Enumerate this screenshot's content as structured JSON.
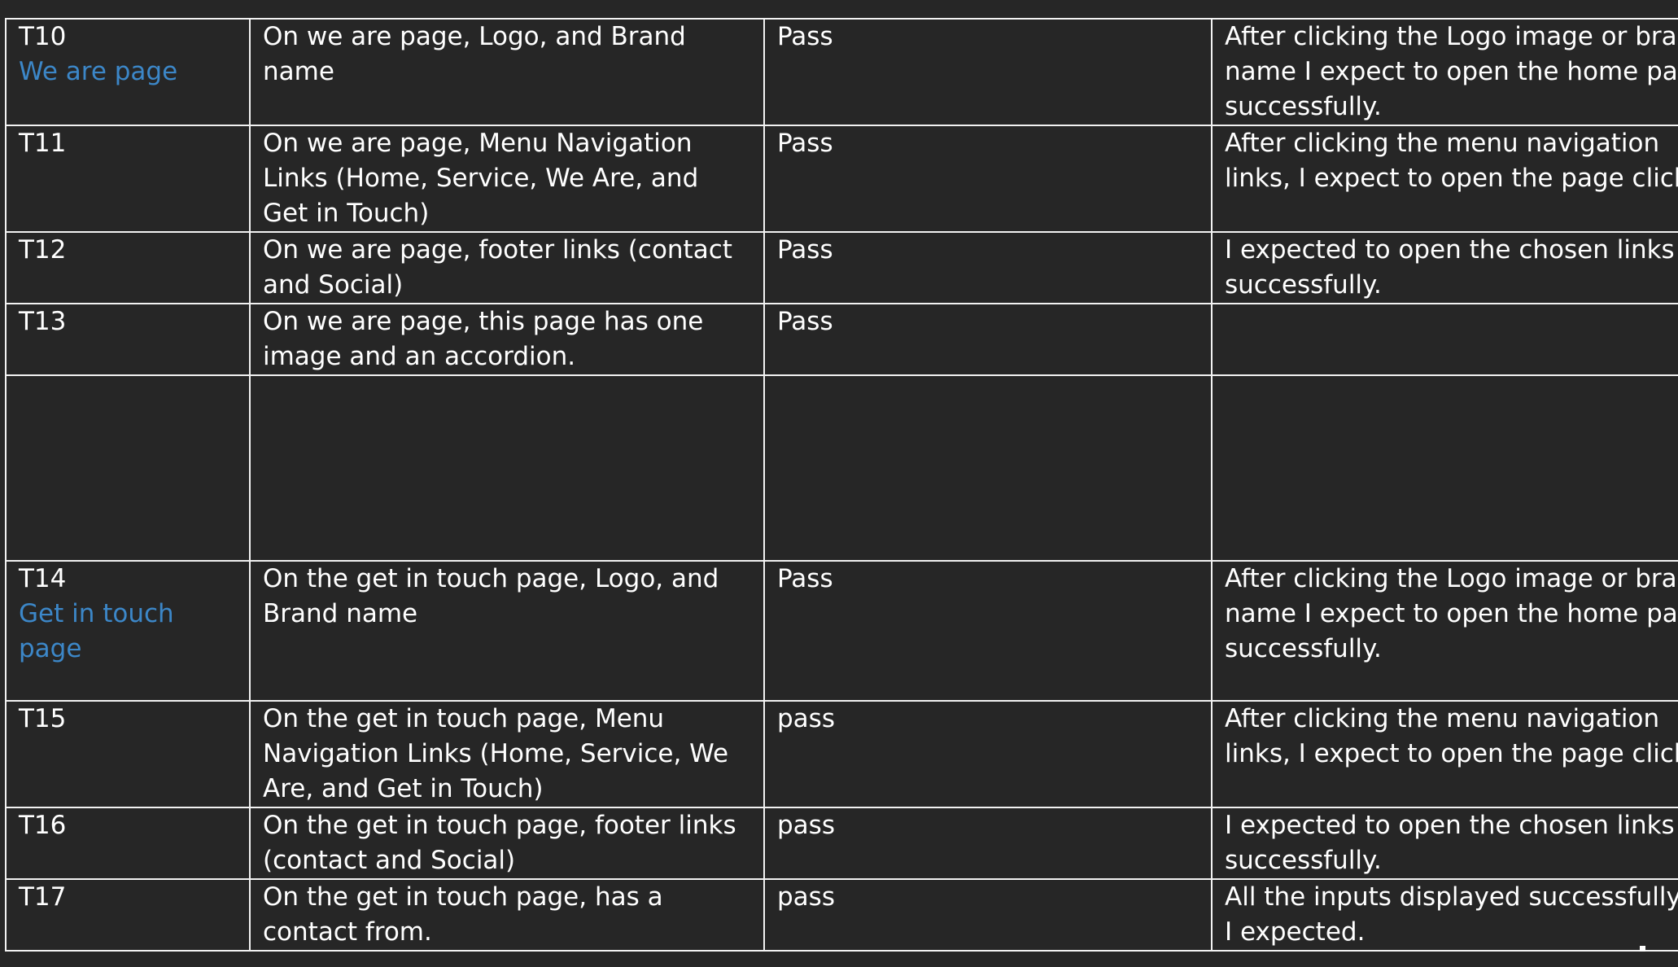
{
  "rows": [
    {
      "id": "T10",
      "section": "We are page",
      "description": "On we are page, Logo, and Brand name",
      "result": "Pass",
      "expected": "After clicking the Logo image or brand name I expect to open the home page successfully."
    },
    {
      "id": "T11",
      "section": "",
      "description": "On we are page, Menu Navigation Links (Home, Service, We Are, and Get in Touch)",
      "result": "Pass",
      "expected": "After clicking the menu navigation links, I expect to open the page clicked"
    },
    {
      "id": "T12",
      "section": "",
      "description": "On we are page, footer links (contact and Social)",
      "result": "Pass",
      "expected": "I expected to open the chosen links successfully."
    },
    {
      "id": "T13",
      "section": "",
      "description": "On we are page, this page has one image and an accordion.",
      "result": "Pass",
      "expected": ""
    },
    {
      "id": "",
      "section": "",
      "description": "",
      "result": "",
      "expected": ""
    },
    {
      "id": "T14",
      "section": "Get in touch page",
      "description": "On the get in touch page, Logo, and Brand name",
      "result": "Pass",
      "expected": "After clicking the Logo image or brand name I expect to open the home page successfully."
    },
    {
      "id": "T15",
      "section": "",
      "description": "On the get in touch page, Menu Navigation Links (Home, Service, We Are, and Get in Touch)",
      "result": "pass",
      "expected": "After clicking the menu navigation links, I expect to open the page clicked"
    },
    {
      "id": "T16",
      "section": "",
      "description": "On the get in touch page, footer links (contact and Social)",
      "result": "pass",
      "expected": "I expected to open the chosen links successfully."
    },
    {
      "id": "T17",
      "section": "",
      "description": "On the get in touch page, has a contact from.",
      "result": "pass",
      "expected": "All the inputs displayed successfully as I expected."
    }
  ],
  "colors": {
    "background": "#262626",
    "text": "#ffffff",
    "section_label": "#3c87c8",
    "border": "#f2f2f2"
  }
}
